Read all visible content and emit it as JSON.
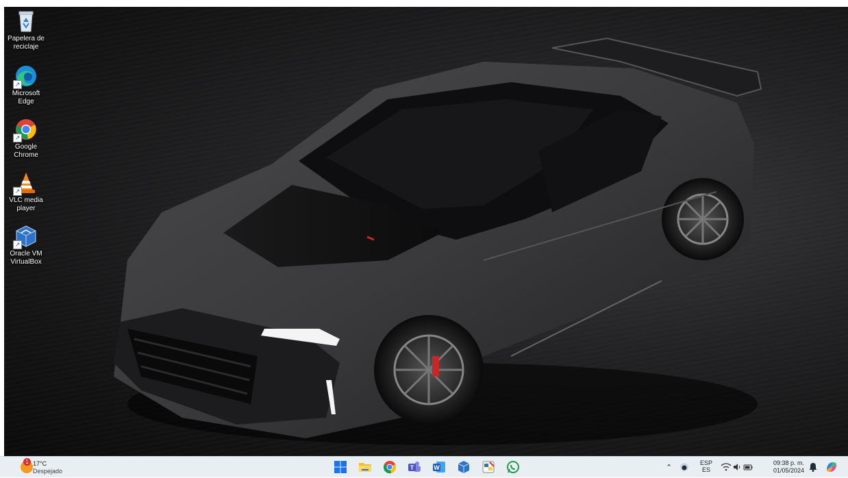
{
  "desktop_icons": [
    {
      "name": "Papelera de reciclaje",
      "icon": "recycle-bin-icon"
    },
    {
      "name": "Microsoft Edge",
      "icon": "edge-icon"
    },
    {
      "name": "Google Chrome",
      "icon": "chrome-icon"
    },
    {
      "name": "VLC media player",
      "icon": "vlc-icon"
    },
    {
      "name": "Oracle VM VirtualBox",
      "icon": "virtualbox-icon"
    }
  ],
  "taskbar": {
    "weather": {
      "temperature": "17°C",
      "condition": "Despejado",
      "alert_count": "1"
    },
    "pinned_apps": [
      {
        "icon": "start-icon"
      },
      {
        "icon": "file-explorer-icon"
      },
      {
        "icon": "chrome-icon"
      },
      {
        "icon": "teams-icon"
      },
      {
        "icon": "word-icon"
      },
      {
        "icon": "virtualbox-icon"
      },
      {
        "icon": "python-idle-icon"
      },
      {
        "icon": "whatsapp-icon"
      }
    ],
    "tray": {
      "language_top": "ESP",
      "language_bottom": "ES",
      "time": "09:38 p. m.",
      "date": "01/05/2024"
    }
  },
  "colors": {
    "taskbar_bg": "#e9eef3",
    "windows_blue": "#1a73e8",
    "weather_orange": "#f29a1e"
  }
}
